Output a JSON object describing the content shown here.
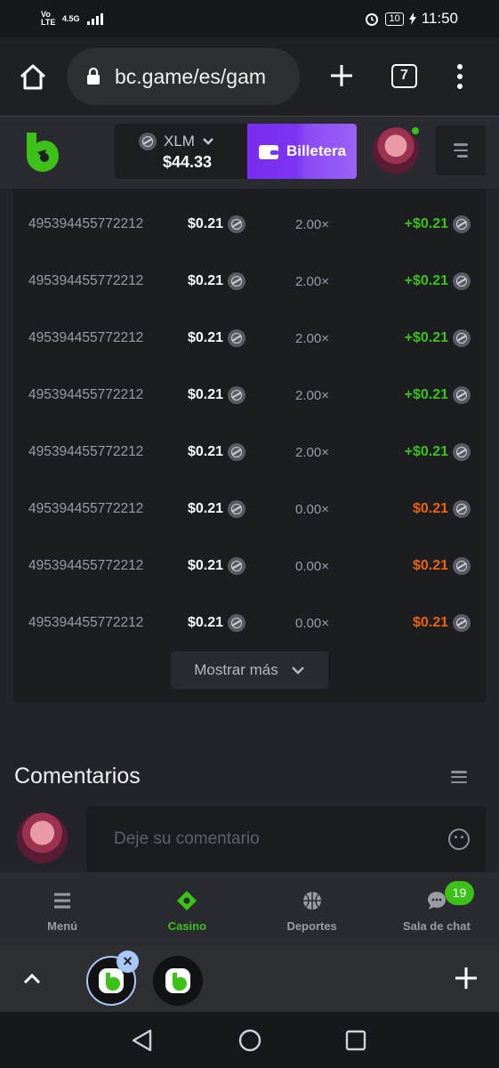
{
  "status_bar": {
    "network": "Vo LTE",
    "signal_type": "4.5G",
    "battery": "10",
    "time": "11:50"
  },
  "browser": {
    "url": "bc.game/es/gam",
    "tab_count": "7"
  },
  "header": {
    "currency": "XLM",
    "balance": "$44.33",
    "wallet_label": "Billetera"
  },
  "bets": {
    "rows": [
      {
        "id": "495394455772212",
        "bet": "$0.21",
        "multiplier": "2.00×",
        "profit": "+$0.21",
        "result": "win"
      },
      {
        "id": "495394455772212",
        "bet": "$0.21",
        "multiplier": "2.00×",
        "profit": "+$0.21",
        "result": "win"
      },
      {
        "id": "495394455772212",
        "bet": "$0.21",
        "multiplier": "2.00×",
        "profit": "+$0.21",
        "result": "win"
      },
      {
        "id": "495394455772212",
        "bet": "$0.21",
        "multiplier": "2.00×",
        "profit": "+$0.21",
        "result": "win"
      },
      {
        "id": "495394455772212",
        "bet": "$0.21",
        "multiplier": "2.00×",
        "profit": "+$0.21",
        "result": "win"
      },
      {
        "id": "495394455772212",
        "bet": "$0.21",
        "multiplier": "0.00×",
        "profit": "$0.21",
        "result": "loss"
      },
      {
        "id": "495394455772212",
        "bet": "$0.21",
        "multiplier": "0.00×",
        "profit": "$0.21",
        "result": "loss"
      },
      {
        "id": "495394455772212",
        "bet": "$0.21",
        "multiplier": "0.00×",
        "profit": "$0.21",
        "result": "loss"
      }
    ],
    "show_more_label": "Mostrar más"
  },
  "comments": {
    "title": "Comentarios",
    "placeholder": "Deje su comentario"
  },
  "bottom_nav": {
    "menu": "Menú",
    "casino": "Casino",
    "sports": "Deportes",
    "chat": "Sala de chat",
    "chat_badge": "19"
  },
  "colors": {
    "win": "#3bc117",
    "loss": "#ed6300",
    "accent": "#7b35f2",
    "brand": "#3bc117"
  }
}
